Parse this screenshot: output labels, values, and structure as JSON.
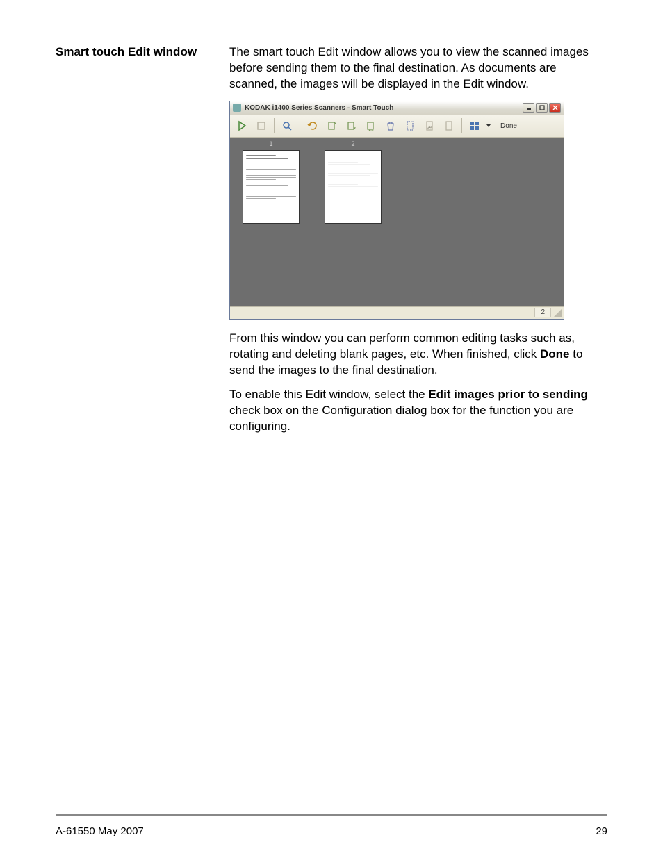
{
  "section_title": "Smart touch Edit window",
  "para1": "The smart touch Edit window allows you to view the scanned images before sending them to the final destination. As documents are scanned, the images will be displayed in the Edit window.",
  "para2_pre": "From this window you can perform common editing tasks such as, rotating and deleting blank pages, etc. When finished, click ",
  "para2_bold": "Done",
  "para2_post": " to send the images to the final destination.",
  "para3_pre": "To enable this Edit window, select the ",
  "para3_bold": "Edit images prior to sending",
  "para3_post": " check box on the Configuration dialog box for the function you are configuring.",
  "window": {
    "title": "KODAK i1400 Series Scanners - Smart Touch",
    "done_label": "Done",
    "thumbs": [
      "1",
      "2"
    ],
    "status_count": "2"
  },
  "footer": {
    "doc_id": "A-61550  May 2007",
    "page_num": "29"
  }
}
